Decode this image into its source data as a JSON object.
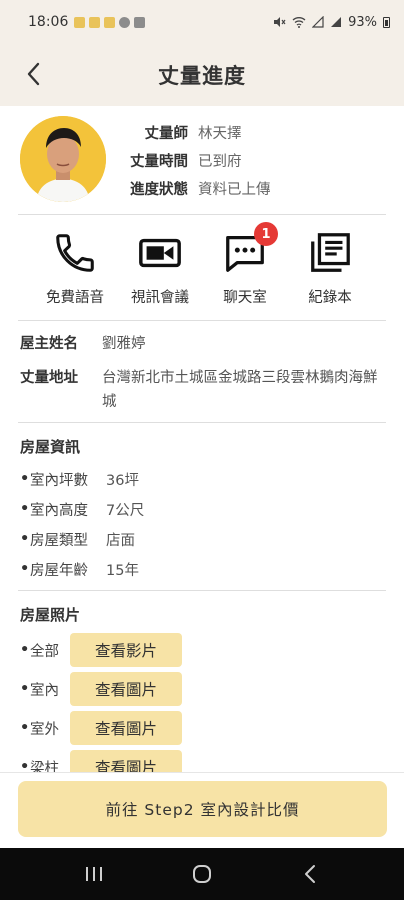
{
  "status_bar": {
    "time": "18:06",
    "battery": "93%"
  },
  "header": {
    "title": "丈量進度"
  },
  "profile": {
    "rows": [
      {
        "label": "丈量師",
        "value": "林天擇"
      },
      {
        "label": "丈量時間",
        "value": "已到府"
      },
      {
        "label": "進度狀態",
        "value": "資料已上傳"
      }
    ]
  },
  "actions": [
    {
      "label": "免費語音",
      "icon": "phone-icon"
    },
    {
      "label": "視訊會議",
      "icon": "video-camera-icon"
    },
    {
      "label": "聊天室",
      "icon": "chat-icon",
      "badge": "1"
    },
    {
      "label": "紀錄本",
      "icon": "notebook-icon"
    }
  ],
  "owner": {
    "name_label": "屋主姓名",
    "name_value": "劉雅婷",
    "address_label": "丈量地址",
    "address_value": "台灣新北市土城區金城路三段雲林鵝肉海鮮城"
  },
  "house_info": {
    "title": "房屋資訊",
    "items": [
      {
        "label": "室內坪數",
        "value": "36坪"
      },
      {
        "label": "室內高度",
        "value": "7公尺"
      },
      {
        "label": "房屋類型",
        "value": "店面"
      },
      {
        "label": "房屋年齡",
        "value": "15年"
      }
    ]
  },
  "house_photos": {
    "title": "房屋照片",
    "items": [
      {
        "label": "全部",
        "button": "查看影片"
      },
      {
        "label": "室內",
        "button": "查看圖片"
      },
      {
        "label": "室外",
        "button": "查看圖片"
      },
      {
        "label": "梁柱",
        "button": "查看圖片"
      }
    ]
  },
  "cta": {
    "label": "前往 Step2 室內設計比價"
  },
  "colors": {
    "accent": "#f7e3a6",
    "header_bg": "#f4efe8",
    "badge": "#e53935",
    "avatar_bg": "#f3c33a"
  }
}
